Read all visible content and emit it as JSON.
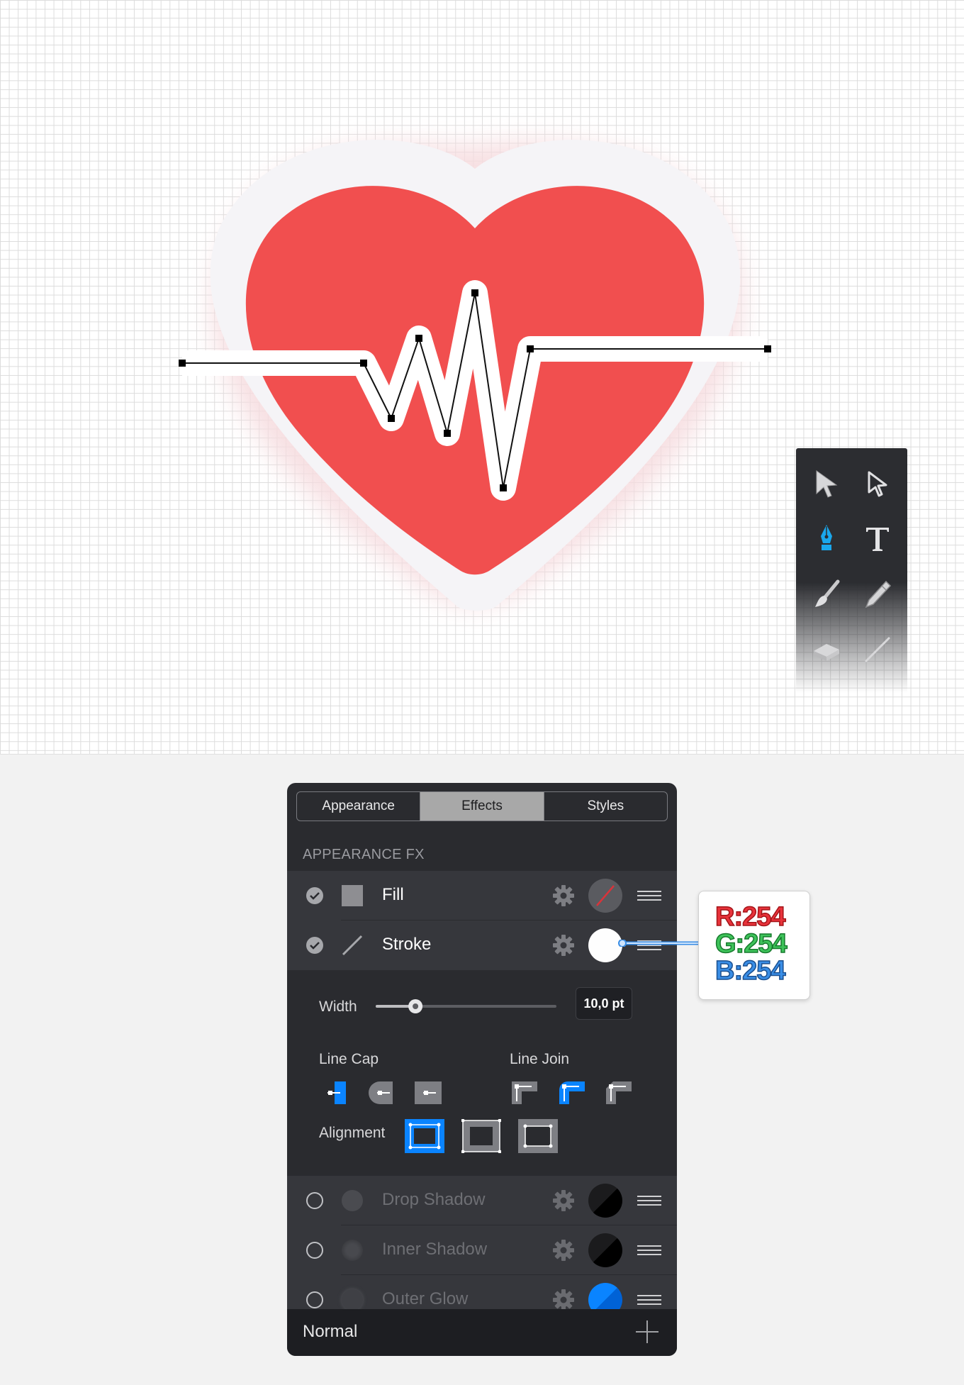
{
  "panel": {
    "tabs": [
      {
        "label": "Appearance",
        "active": false
      },
      {
        "label": "Effects",
        "active": true
      },
      {
        "label": "Styles",
        "active": false
      }
    ],
    "section_title": "APPEARANCE FX",
    "effects": [
      {
        "label": "Fill",
        "enabled": true,
        "color": "none"
      },
      {
        "label": "Stroke",
        "enabled": true,
        "color": "#fefefe"
      },
      {
        "label": "Drop Shadow",
        "enabled": false,
        "color": "#000000"
      },
      {
        "label": "Inner Shadow",
        "enabled": false,
        "color": "#000000"
      },
      {
        "label": "Outer Glow",
        "enabled": false,
        "color": "#0a84ff"
      }
    ],
    "stroke_options": {
      "width_label": "Width",
      "width_value": "10,0 pt",
      "width_fraction": 0.22,
      "line_cap_label": "Line Cap",
      "line_cap_selected": "butt",
      "line_join_label": "Line Join",
      "line_join_selected": "round",
      "alignment_label": "Alignment",
      "alignment_selected": "center"
    },
    "blend_mode": "Normal"
  },
  "rgb_callout": {
    "r": "R:254",
    "g": "G:254",
    "b": "B:254"
  },
  "toolbox": {
    "tools": [
      "select-arrow",
      "direct-select-arrow",
      "pen",
      "text",
      "brush",
      "pencil",
      "eraser",
      "line"
    ],
    "active_tool": "pen"
  },
  "colors": {
    "heart": "#f14f4f",
    "accent": "#0a84ff",
    "panel_bg": "#2a2b2f"
  }
}
